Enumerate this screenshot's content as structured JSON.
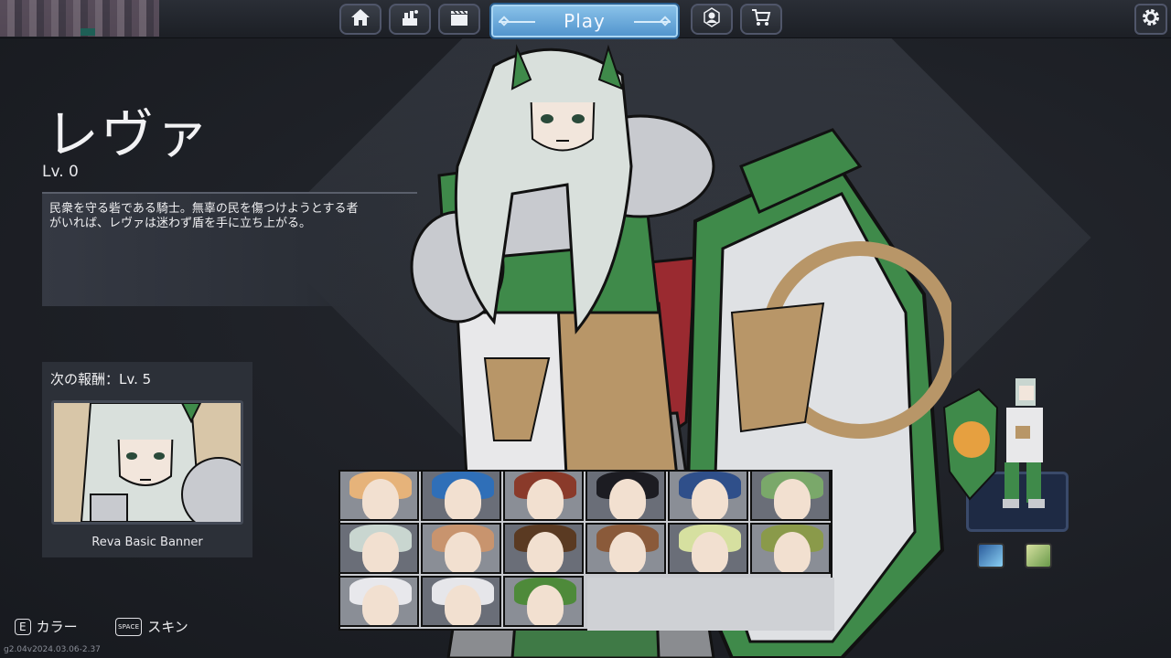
{
  "nav": {
    "home_icon": "home-icon",
    "library_icon": "library-icon",
    "clapper_icon": "clapperboard-icon",
    "play_label": "Play",
    "hero_icon": "hero-bust-icon",
    "shop_icon": "cart-icon",
    "settings_icon": "gear-icon"
  },
  "character": {
    "name": "レヴァ",
    "level": "Lv. 0",
    "description_line1": "民衆を守る砦である騎士。無辜の民を傷つけようとする者",
    "description_line2": "がいれば、レヴァは迷わず盾を手に立ち上がる。"
  },
  "reward": {
    "title": "次の報酬：Lv. 5",
    "item_label": "Reva Basic Banner"
  },
  "roster": {
    "count": 15,
    "hair_colors": [
      "#e6b37a",
      "#2f6fb8",
      "#8a3a2a",
      "#1c1c22",
      "#2f4f8a",
      "#7aa86a",
      "#c9d6d0",
      "#c8946e",
      "#5a3a22",
      "#8a5a3a",
      "#d6e0a0",
      "#8a9a4a",
      "#e8e8ec",
      "#e6e6ea",
      "#4e8a3a"
    ]
  },
  "hints": {
    "color_key": "E",
    "color_label": "カラー",
    "skin_key": "SPACE",
    "skin_label": "スキン"
  },
  "version": "g2.04v2024.03.06-2.37",
  "colors": {
    "play_button": "#6aaae0",
    "background": "#1f2229",
    "armor_green": "#3f8a4a"
  }
}
